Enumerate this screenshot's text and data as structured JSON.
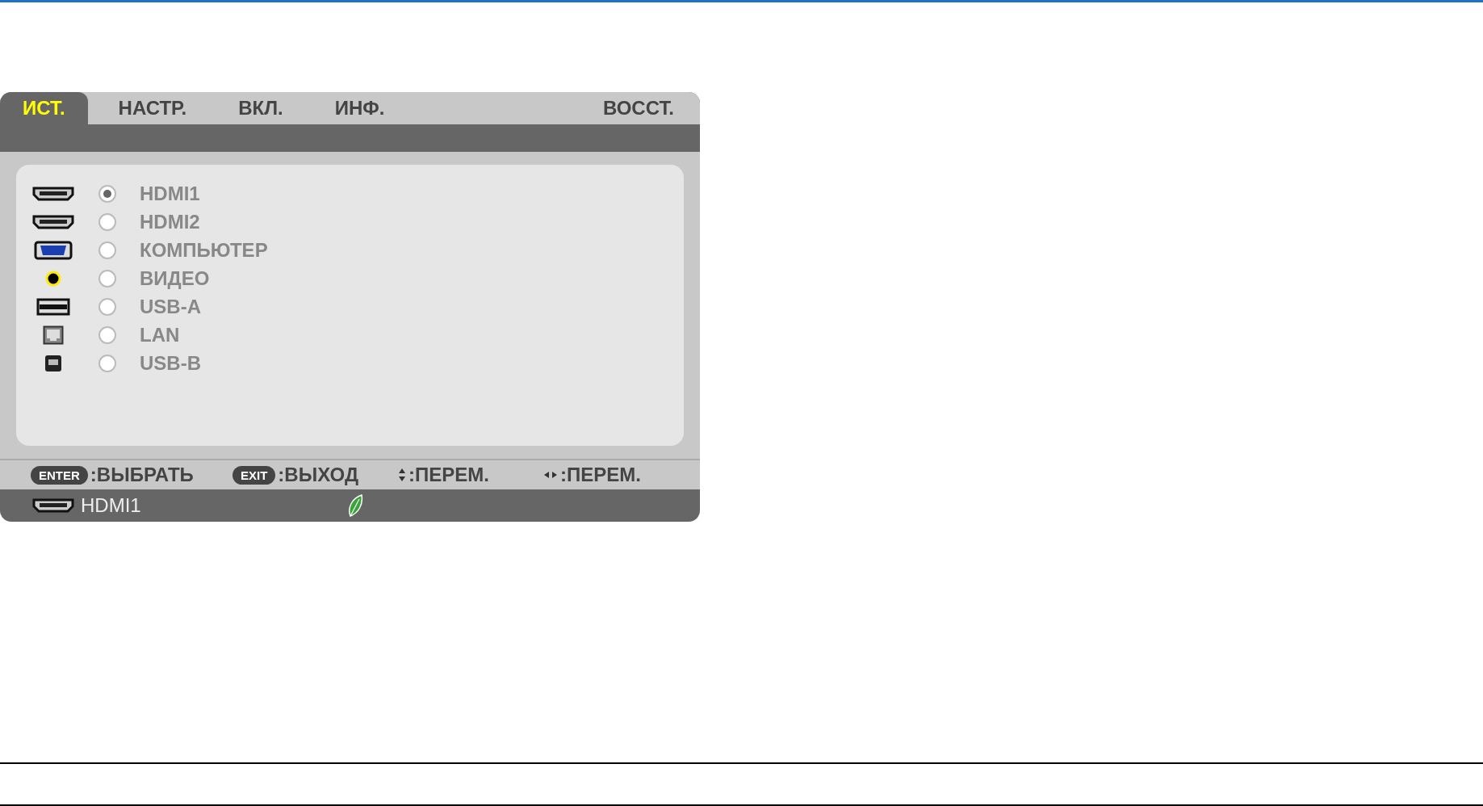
{
  "tabs": [
    {
      "label": "ИСТ.",
      "selected": true
    },
    {
      "label": "НАСТР.",
      "selected": false
    },
    {
      "label": "ВКЛ.",
      "selected": false
    },
    {
      "label": "ИНФ.",
      "selected": false
    },
    {
      "label": "ВОССТ.",
      "selected": false
    }
  ],
  "inputs": [
    {
      "label": "HDMI1",
      "kind": "hdmi",
      "selected": true
    },
    {
      "label": "HDMI2",
      "kind": "hdmi",
      "selected": false
    },
    {
      "label": "КОМПЬЮТЕР",
      "kind": "vga",
      "selected": false
    },
    {
      "label": "ВИДЕО",
      "kind": "rca",
      "selected": false
    },
    {
      "label": "USB-A",
      "kind": "usb-a",
      "selected": false
    },
    {
      "label": "LAN",
      "kind": "lan",
      "selected": false
    },
    {
      "label": "USB-B",
      "kind": "usb-b",
      "selected": false
    }
  ],
  "hints": [
    {
      "kind": "key",
      "key": "ENTER",
      "label": ":ВЫБРАТЬ"
    },
    {
      "kind": "key",
      "key": "EXIT",
      "label": ":ВЫХОД"
    },
    {
      "kind": "updown",
      "label": ":ПЕРЕМ."
    },
    {
      "kind": "leftright",
      "label": ":ПЕРЕМ."
    }
  ],
  "status": {
    "kind": "hdmi",
    "label": "HDMI1"
  }
}
